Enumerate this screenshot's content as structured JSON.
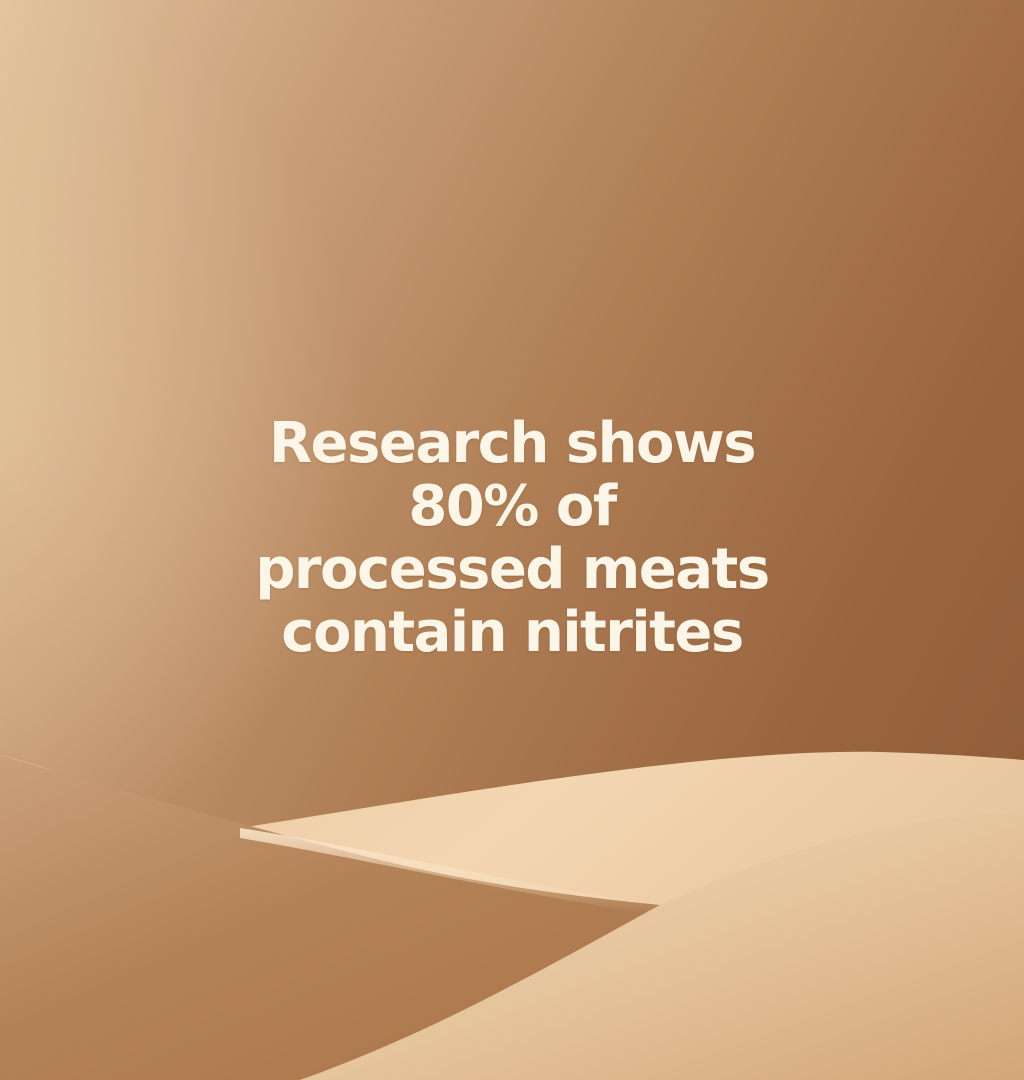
{
  "message": {
    "lines": [
      "Research shows",
      "80% of",
      "processed meats",
      "contain nitrites"
    ],
    "color": "#fcf6e8"
  },
  "background": {
    "gradient_colors": [
      "#e3c49c",
      "#c9a07a",
      "#b07f56",
      "#99663f",
      "#8c5a36"
    ],
    "dune_colors": [
      "#f0cfa6",
      "#e2bc8f",
      "#c29068"
    ]
  }
}
